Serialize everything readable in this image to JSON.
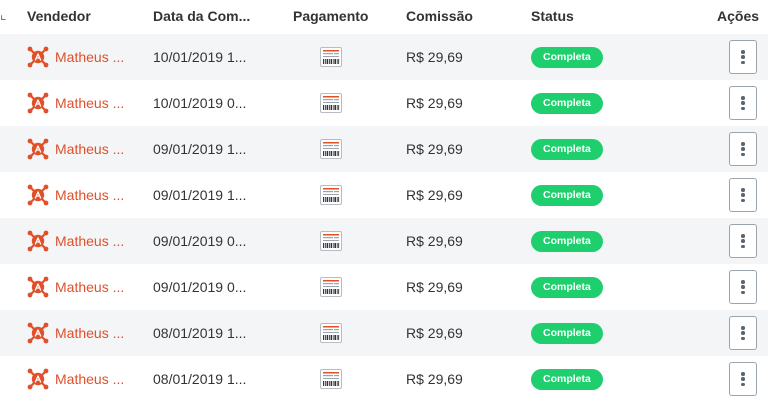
{
  "table": {
    "columns": {
      "vendedor": "Vendedor",
      "data": "Data da Com...",
      "pagamento": "Pagamento",
      "comissao": "Comissão",
      "status": "Status",
      "acoes": "Ações"
    },
    "rows": [
      {
        "vendor": "Matheus ...",
        "date": "10/01/2019 1...",
        "commission": "R$ 29,69",
        "status": "Completa"
      },
      {
        "vendor": "Matheus ...",
        "date": "10/01/2019 0...",
        "commission": "R$ 29,69",
        "status": "Completa"
      },
      {
        "vendor": "Matheus ...",
        "date": "09/01/2019 1...",
        "commission": "R$ 29,69",
        "status": "Completa"
      },
      {
        "vendor": "Matheus ...",
        "date": "09/01/2019 1...",
        "commission": "R$ 29,69",
        "status": "Completa"
      },
      {
        "vendor": "Matheus ...",
        "date": "09/01/2019 0...",
        "commission": "R$ 29,69",
        "status": "Completa"
      },
      {
        "vendor": "Matheus ...",
        "date": "09/01/2019 0...",
        "commission": "R$ 29,69",
        "status": "Completa"
      },
      {
        "vendor": "Matheus ...",
        "date": "08/01/2019 1...",
        "commission": "R$ 29,69",
        "status": "Completa"
      },
      {
        "vendor": "Matheus ...",
        "date": "08/01/2019 1...",
        "commission": "R$ 29,69",
        "status": "Completa"
      }
    ]
  },
  "icons": {
    "vendor": "vendor-logo-icon",
    "payment": "boleto-barcode-icon",
    "actions": "kebab-menu-icon"
  },
  "colors": {
    "vendor_text": "#e0502a",
    "status_badge": "#1fcf6e",
    "row_alt": "#f3f5f7"
  }
}
